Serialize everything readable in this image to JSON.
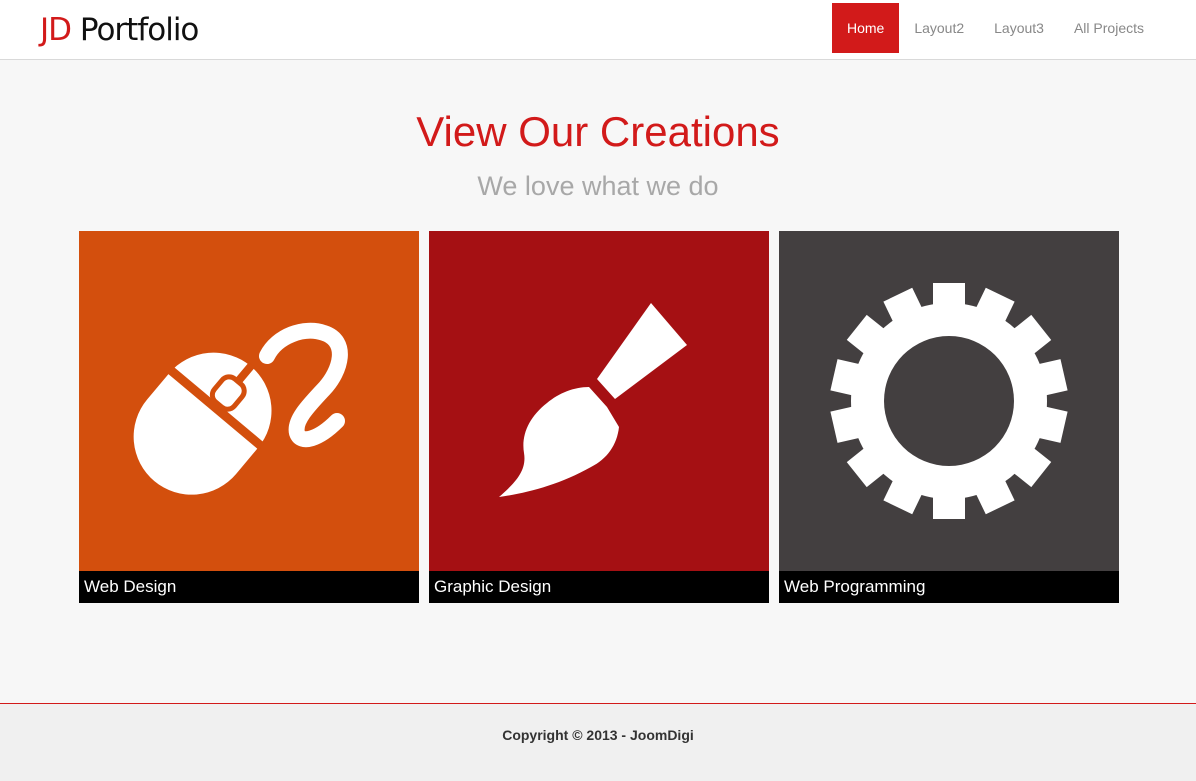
{
  "header": {
    "logo_accent": "JD",
    "logo_text": "Portfolio",
    "nav": [
      {
        "label": "Home",
        "active": true
      },
      {
        "label": "Layout2",
        "active": false
      },
      {
        "label": "Layout3",
        "active": false
      },
      {
        "label": "All Projects",
        "active": false
      }
    ]
  },
  "hero": {
    "title": "View Our Creations",
    "subtitle": "We love what we do"
  },
  "tiles": [
    {
      "caption": "Web Design",
      "icon": "mouse-icon",
      "color": "#d34f0d"
    },
    {
      "caption": "Graphic Design",
      "icon": "paintbrush-icon",
      "color": "#a51013"
    },
    {
      "caption": "Web Programming",
      "icon": "gear-icon",
      "color": "#433f40"
    }
  ],
  "footer": {
    "copyright": "Copyright © 2013 - JoomDigi"
  },
  "colors": {
    "accent": "#d21a1a",
    "nav_text": "#888888",
    "subtitle": "#a8a8a8",
    "background": "#f7f7f7"
  }
}
